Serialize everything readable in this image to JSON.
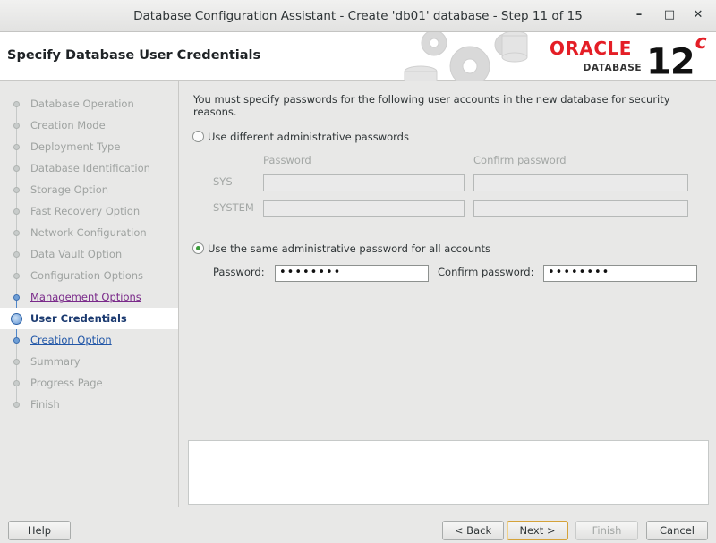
{
  "window": {
    "title": "Database Configuration Assistant - Create 'db01' database - Step 11 of 15",
    "minimize": "–",
    "maximize": "□",
    "close": "✕"
  },
  "header": {
    "page_title": "Specify Database User Credentials",
    "brand_word": "ORACLE",
    "brand_sub": "DATABASE",
    "version_number": "12",
    "version_suffix": "c",
    "brand_color": "#e41e26"
  },
  "steps": [
    {
      "label": "Database Operation",
      "state": "inactive"
    },
    {
      "label": "Creation Mode",
      "state": "inactive"
    },
    {
      "label": "Deployment Type",
      "state": "inactive"
    },
    {
      "label": "Database Identification",
      "state": "inactive"
    },
    {
      "label": "Storage Option",
      "state": "inactive"
    },
    {
      "label": "Fast Recovery Option",
      "state": "inactive"
    },
    {
      "label": "Network Configuration",
      "state": "inactive"
    },
    {
      "label": "Data Vault Option",
      "state": "inactive"
    },
    {
      "label": "Configuration Options",
      "state": "inactive"
    },
    {
      "label": "Management Options",
      "state": "visited"
    },
    {
      "label": "User Credentials",
      "state": "current"
    },
    {
      "label": "Creation Option",
      "state": "link"
    },
    {
      "label": "Summary",
      "state": "inactive"
    },
    {
      "label": "Progress Page",
      "state": "inactive"
    },
    {
      "label": "Finish",
      "state": "inactive"
    }
  ],
  "main": {
    "intro": "You must specify passwords for the following user accounts in the new database for security reasons.",
    "option_different": "Use different administrative passwords",
    "col_password": "Password",
    "col_confirm": "Confirm password",
    "row_sys": "SYS",
    "row_system": "SYSTEM",
    "option_same": "Use the same administrative password for all accounts",
    "password_label": "Password:",
    "password_value": "••••••••",
    "confirm_label": "Confirm password:",
    "confirm_value": "••••••••",
    "selected_option": "same"
  },
  "buttons": {
    "help": "Help",
    "back": "< Back",
    "next": "Next >",
    "finish": "Finish",
    "cancel": "Cancel"
  }
}
